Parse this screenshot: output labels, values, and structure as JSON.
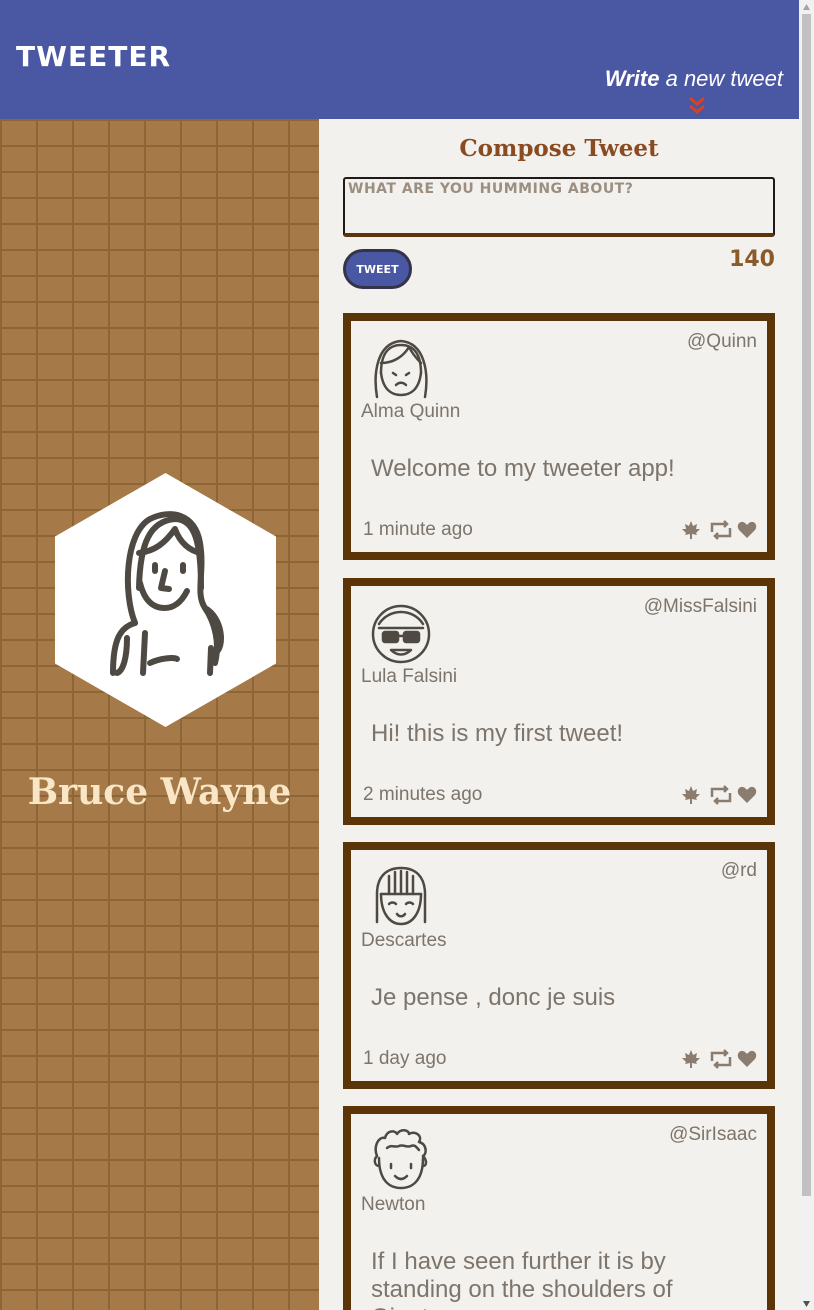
{
  "nav": {
    "brand": "TWEETER",
    "write_bold": "Write",
    "write_rest": "a new tweet",
    "chevron_icon": "double-chevron-down-icon",
    "accent": "#d9421f",
    "bg": "#4a57a3"
  },
  "profile": {
    "name": "Bruce Wayne",
    "avatar_icon": "user-avatar-icon"
  },
  "compose": {
    "title": "Compose Tweet",
    "placeholder": "WHAT ARE YOU HUMMING ABOUT?",
    "button_label": "TWEET",
    "counter": "140"
  },
  "tweets": [
    {
      "name": "Alma Quinn",
      "handle": "@Quinn",
      "content": "Welcome to my tweeter app!",
      "time": "1 minute ago",
      "avatar_icon": "girl-avatar-icon"
    },
    {
      "name": "Lula Falsini",
      "handle": "@MissFalsini",
      "content": "Hi! this is my first tweet!",
      "time": "2 minutes ago",
      "avatar_icon": "glasses-avatar-icon"
    },
    {
      "name": "Descartes",
      "handle": "@rd",
      "content": "Je pense , donc je suis",
      "time": "1 day ago",
      "avatar_icon": "smiling-avatar-icon"
    },
    {
      "name": "Newton",
      "handle": "@SirIsaac",
      "content": "If I have seen further it is by standing on the shoulders of Giants",
      "time": "",
      "avatar_icon": "curly-hair-avatar-icon"
    }
  ],
  "actions": [
    "flag-icon",
    "retweet-icon",
    "heart-icon"
  ]
}
